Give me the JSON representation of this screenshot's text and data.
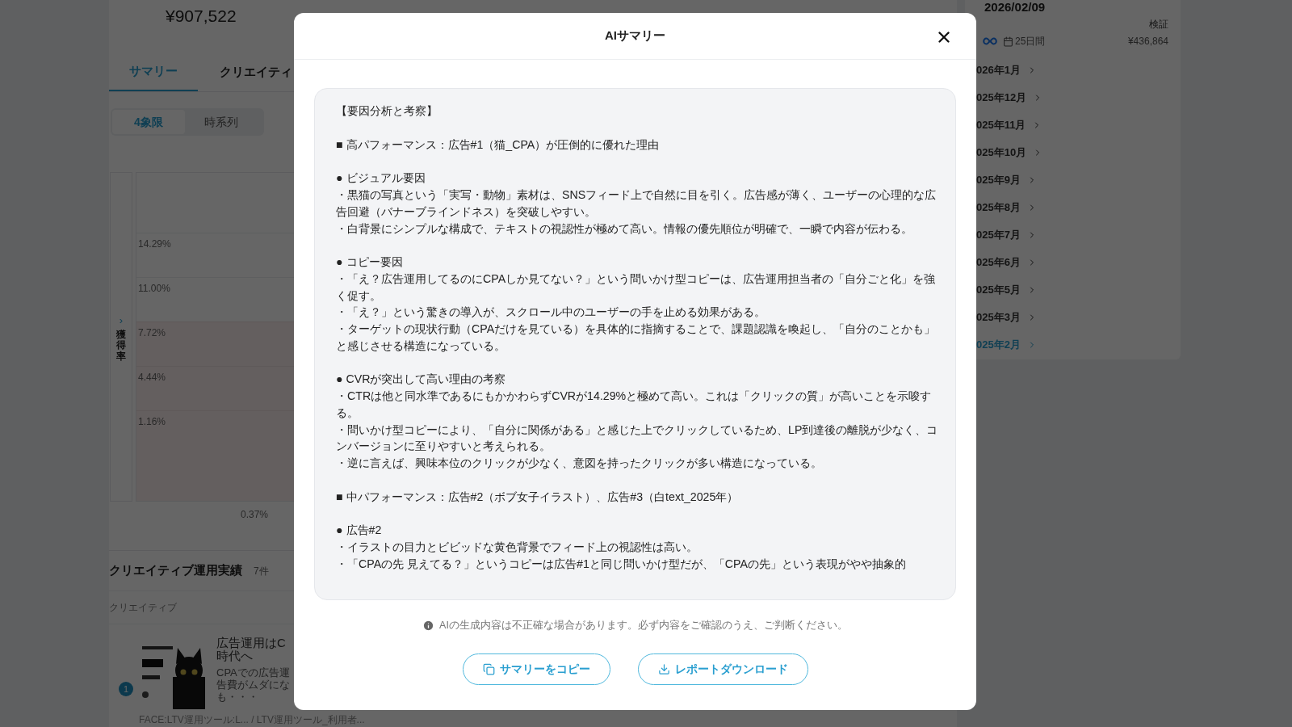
{
  "background": {
    "stats": [
      "¥907,522"
    ],
    "tabs": [
      {
        "label": "サマリー",
        "selected": true
      },
      {
        "label": "クリエイティ",
        "selected": false
      }
    ],
    "view_toggle": [
      {
        "label": "4象限",
        "selected": true
      },
      {
        "label": "時系列",
        "selected": false
      }
    ],
    "chart": {
      "axis_label": "獲得率",
      "axis_toggle": "›",
      "y_ticks": [
        "14.29%",
        "11.00%",
        "7.72%",
        "4.44%",
        "1.16%"
      ],
      "x_ticks": [
        "0.37%"
      ]
    },
    "creatives": {
      "title": "クリエイティブ運用実績",
      "count": "7件",
      "column": "クリエイティブ",
      "rows": [
        {
          "rank": "1",
          "title_lines": [
            "広告運用はC",
            "時代へ"
          ],
          "description_lines": [
            "CPAでの広告運",
            "告費がムダにな",
            "も・・・"
          ],
          "tags": "FACE:LTV運用ツール:L...  / LTV運用ツール_利用者..."
        }
      ]
    }
  },
  "sidebar": {
    "date": "2026/02/09",
    "note": "検証",
    "duration": "25日間",
    "amount": "¥436,864",
    "months": [
      {
        "label": "026年1月",
        "selected": false
      },
      {
        "label": "025年12月",
        "selected": false
      },
      {
        "label": "025年11月",
        "selected": false
      },
      {
        "label": "025年10月",
        "selected": false
      },
      {
        "label": "025年9月",
        "selected": false
      },
      {
        "label": "025年8月",
        "selected": false
      },
      {
        "label": "025年7月",
        "selected": false
      },
      {
        "label": "025年6月",
        "selected": false
      },
      {
        "label": "025年5月",
        "selected": false
      },
      {
        "label": "025年3月",
        "selected": false
      },
      {
        "label": "025年2月",
        "selected": true
      }
    ]
  },
  "dialog": {
    "title": "AIサマリー",
    "summary_blocks": [
      {
        "lines": [
          "【要因分析と考察】"
        ]
      },
      {
        "lines": [
          "■ 高パフォーマンス：広告#1（猫_CPA）が圧倒的に優れた理由"
        ]
      },
      {
        "lines": [
          "● ビジュアル要因",
          "・黒猫の写真という「実写・動物」素材は、SNSフィード上で自然に目を引く。広告感が薄く、ユーザーの心理的な広告回避（バナーブラインドネス）を突破しやすい。",
          "・白背景にシンプルな構成で、テキストの視認性が極めて高い。情報の優先順位が明確で、一瞬で内容が伝わる。"
        ]
      },
      {
        "lines": [
          "● コピー要因",
          "・「え？広告運用してるのにCPAしか見てない？」という問いかけ型コピーは、広告運用担当者の「自分ごと化」を強く促す。",
          "・「え？」という驚きの導入が、スクロール中のユーザーの手を止める効果がある。",
          "・ターゲットの現状行動（CPAだけを見ている）を具体的に指摘することで、課題認識を喚起し、「自分のことかも」と感じさせる構造になっている。"
        ]
      },
      {
        "lines": [
          "● CVRが突出して高い理由の考察",
          "・CTRは他と同水準であるにもかかわらずCVRが14.29%と極めて高い。これは「クリックの質」が高いことを示唆する。",
          "・問いかけ型コピーにより、「自分に関係がある」と感じた上でクリックしているため、LP到達後の離脱が少なく、コンバージョンに至りやすいと考えられる。",
          "・逆に言えば、興味本位のクリックが少なく、意図を持ったクリックが多い構造になっている。"
        ]
      },
      {
        "lines": [
          "■ 中パフォーマンス：広告#2（ボブ女子イラスト）、広告#3（白text_2025年）"
        ]
      },
      {
        "lines": [
          "● 広告#2",
          "・イラストの目力とビビッドな黄色背景でフィード上の視認性は高い。",
          "・「CPAの先 見えてる？」というコピーは広告#1と同じ問いかけ型だが、「CPAの先」という表現がやや抽象的"
        ]
      }
    ],
    "disclaimer": "AIの生成内容は不正確な場合があります。必ず内容をご確認のうえ、ご判断ください。",
    "buttons": [
      {
        "kind": "copy",
        "label": "サマリーをコピー"
      },
      {
        "kind": "download",
        "label": "レポートダウンロード"
      }
    ]
  }
}
